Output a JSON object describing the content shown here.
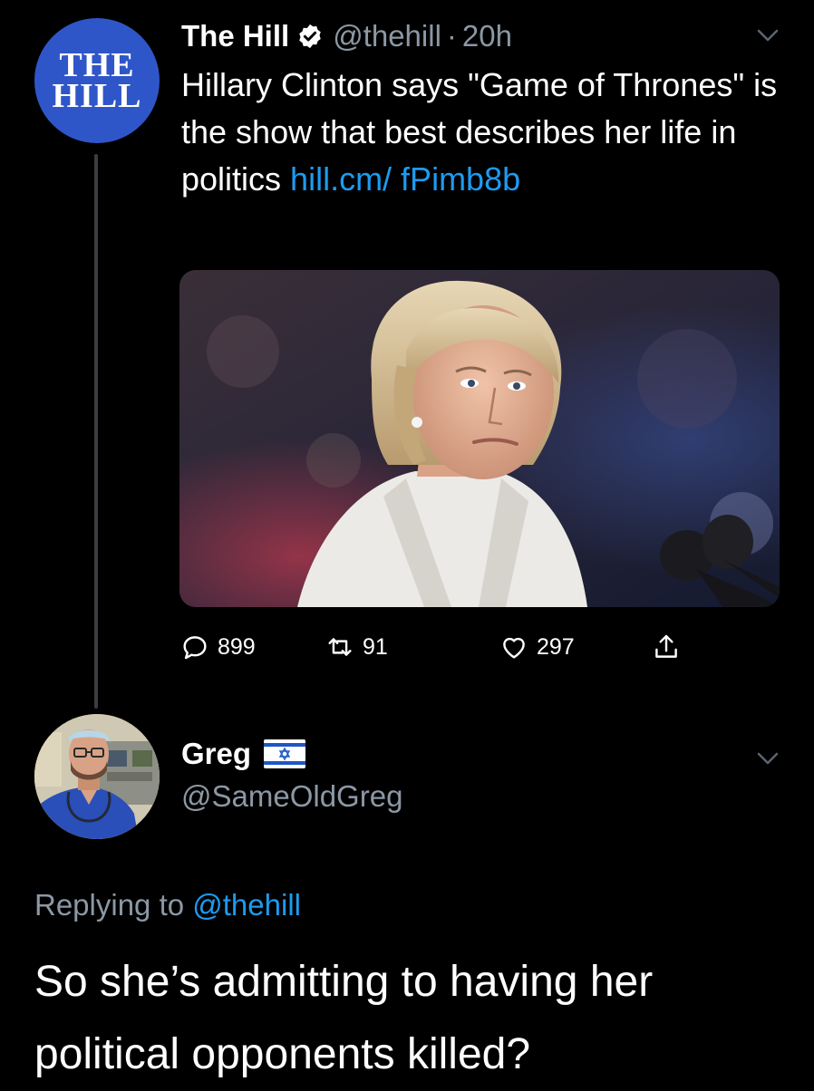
{
  "tweet": {
    "avatar_logo_line1": "THE",
    "avatar_logo_line2": "HILL",
    "display_name": "The Hill",
    "handle": "@thehill",
    "separator": "·",
    "time": "20h",
    "text": "Hillary Clinton says \"Game of Thrones\" is the show that best describes her life in politics ",
    "link": "hill.cm/ fPimb8b",
    "actions": {
      "replies": "899",
      "retweets": "91",
      "likes": "297"
    }
  },
  "reply": {
    "display_name": "Greg",
    "handle": "@SameOldGreg",
    "replying_prefix": "Replying to ",
    "replying_to": "@thehill",
    "text": "So she’s admitting to having her political opponents killed?"
  },
  "icons": [
    "verified-badge-icon",
    "chevron-down-icon",
    "reply-icon",
    "retweet-icon",
    "like-icon",
    "share-icon",
    "israel-flag-icon"
  ],
  "colors": {
    "background": "#000000",
    "link": "#1d9bf0",
    "secondary_text": "#8b98a5",
    "hill_brand": "#2f56c8",
    "thread_line": "#3a3d42"
  }
}
